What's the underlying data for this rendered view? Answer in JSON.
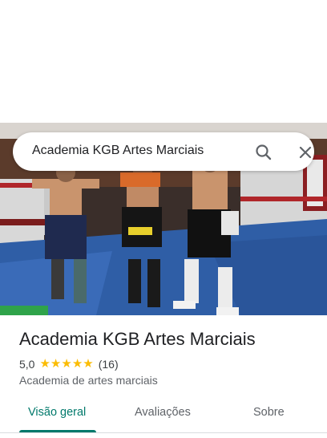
{
  "search": {
    "query": "Academia KGB Artes Marciais",
    "search_icon": "search-icon",
    "close_icon": "close-icon"
  },
  "place": {
    "name": "Academia KGB Artes Marciais",
    "rating": "5,0",
    "stars": 5,
    "reviews": "(16)",
    "category": "Academia de artes marciais"
  },
  "tabs": [
    {
      "label": "Visão geral",
      "active": true
    },
    {
      "label": "Avaliações",
      "active": false
    },
    {
      "label": "Sobre",
      "active": false
    }
  ],
  "colors": {
    "accent": "#00796b",
    "star": "#fbbc04"
  }
}
